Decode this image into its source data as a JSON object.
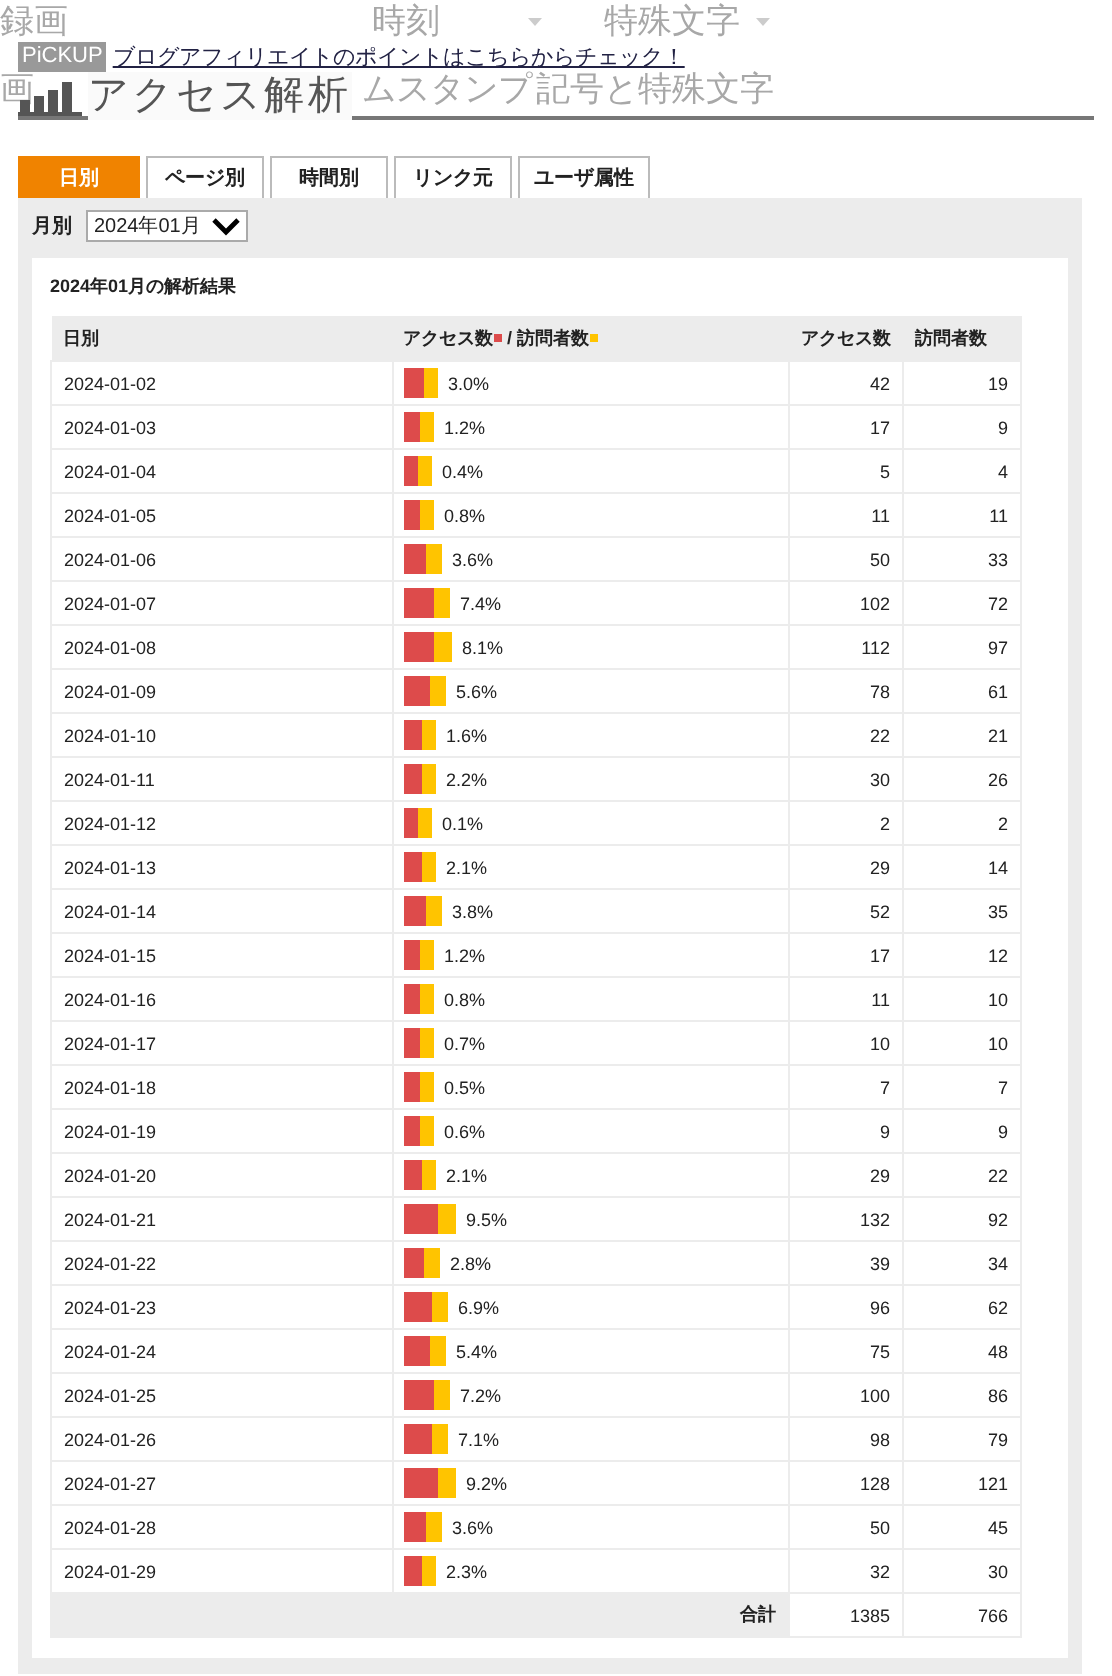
{
  "background_nav": [
    {
      "text": "録画",
      "caret": false
    },
    {
      "text": "時刻",
      "caret": true
    },
    {
      "text": "特殊文字",
      "caret": true
    },
    {
      "text": "画",
      "caret": false
    },
    {
      "text": "ムスタンプ",
      "caret": false
    },
    {
      "text": "記号と特殊文字",
      "caret": false
    }
  ],
  "pickup": {
    "badge": "PiCKUP",
    "link": "ブログアフィリエイトのポイントはこちらからチェック！"
  },
  "title": "アクセス解析",
  "tabs": [
    {
      "label": "日別",
      "selected": true
    },
    {
      "label": "ページ別",
      "selected": false
    },
    {
      "label": "時間別",
      "selected": false
    },
    {
      "label": "リンク元",
      "selected": false
    },
    {
      "label": "ユーザ属性",
      "selected": false
    }
  ],
  "month_filter": {
    "label": "月別",
    "value": "2024年01月"
  },
  "results_title": "2024年01月の解析結果",
  "table": {
    "columns": [
      "日別",
      "アクセス数",
      "/ 訪問者数",
      "アクセス数",
      "訪問者数"
    ],
    "rows": [
      {
        "date": "2024-01-02",
        "percent": "3.0%",
        "access": "42",
        "visitors": "19"
      },
      {
        "date": "2024-01-03",
        "percent": "1.2%",
        "access": "17",
        "visitors": "9"
      },
      {
        "date": "2024-01-04",
        "percent": "0.4%",
        "access": "5",
        "visitors": "4"
      },
      {
        "date": "2024-01-05",
        "percent": "0.8%",
        "access": "11",
        "visitors": "11"
      },
      {
        "date": "2024-01-06",
        "percent": "3.6%",
        "access": "50",
        "visitors": "33"
      },
      {
        "date": "2024-01-07",
        "percent": "7.4%",
        "access": "102",
        "visitors": "72"
      },
      {
        "date": "2024-01-08",
        "percent": "8.1%",
        "access": "112",
        "visitors": "97"
      },
      {
        "date": "2024-01-09",
        "percent": "5.6%",
        "access": "78",
        "visitors": "61"
      },
      {
        "date": "2024-01-10",
        "percent": "1.6%",
        "access": "22",
        "visitors": "21"
      },
      {
        "date": "2024-01-11",
        "percent": "2.2%",
        "access": "30",
        "visitors": "26"
      },
      {
        "date": "2024-01-12",
        "percent": "0.1%",
        "access": "2",
        "visitors": "2"
      },
      {
        "date": "2024-01-13",
        "percent": "2.1%",
        "access": "29",
        "visitors": "14"
      },
      {
        "date": "2024-01-14",
        "percent": "3.8%",
        "access": "52",
        "visitors": "35"
      },
      {
        "date": "2024-01-15",
        "percent": "1.2%",
        "access": "17",
        "visitors": "12"
      },
      {
        "date": "2024-01-16",
        "percent": "0.8%",
        "access": "11",
        "visitors": "10"
      },
      {
        "date": "2024-01-17",
        "percent": "0.7%",
        "access": "10",
        "visitors": "10"
      },
      {
        "date": "2024-01-18",
        "percent": "0.5%",
        "access": "7",
        "visitors": "7"
      },
      {
        "date": "2024-01-19",
        "percent": "0.6%",
        "access": "9",
        "visitors": "9"
      },
      {
        "date": "2024-01-20",
        "percent": "2.1%",
        "access": "29",
        "visitors": "22"
      },
      {
        "date": "2024-01-21",
        "percent": "9.5%",
        "access": "132",
        "visitors": "92"
      },
      {
        "date": "2024-01-22",
        "percent": "2.8%",
        "access": "39",
        "visitors": "34"
      },
      {
        "date": "2024-01-23",
        "percent": "6.9%",
        "access": "96",
        "visitors": "62"
      },
      {
        "date": "2024-01-24",
        "percent": "5.4%",
        "access": "75",
        "visitors": "48"
      },
      {
        "date": "2024-01-25",
        "percent": "7.2%",
        "access": "100",
        "visitors": "86"
      },
      {
        "date": "2024-01-26",
        "percent": "7.1%",
        "access": "98",
        "visitors": "79"
      },
      {
        "date": "2024-01-27",
        "percent": "9.2%",
        "access": "128",
        "visitors": "121"
      },
      {
        "date": "2024-01-28",
        "percent": "3.6%",
        "access": "50",
        "visitors": "45"
      },
      {
        "date": "2024-01-29",
        "percent": "2.3%",
        "access": "32",
        "visitors": "30"
      }
    ],
    "total": {
      "label": "合計",
      "access": "1385",
      "visitors": "766"
    }
  }
}
